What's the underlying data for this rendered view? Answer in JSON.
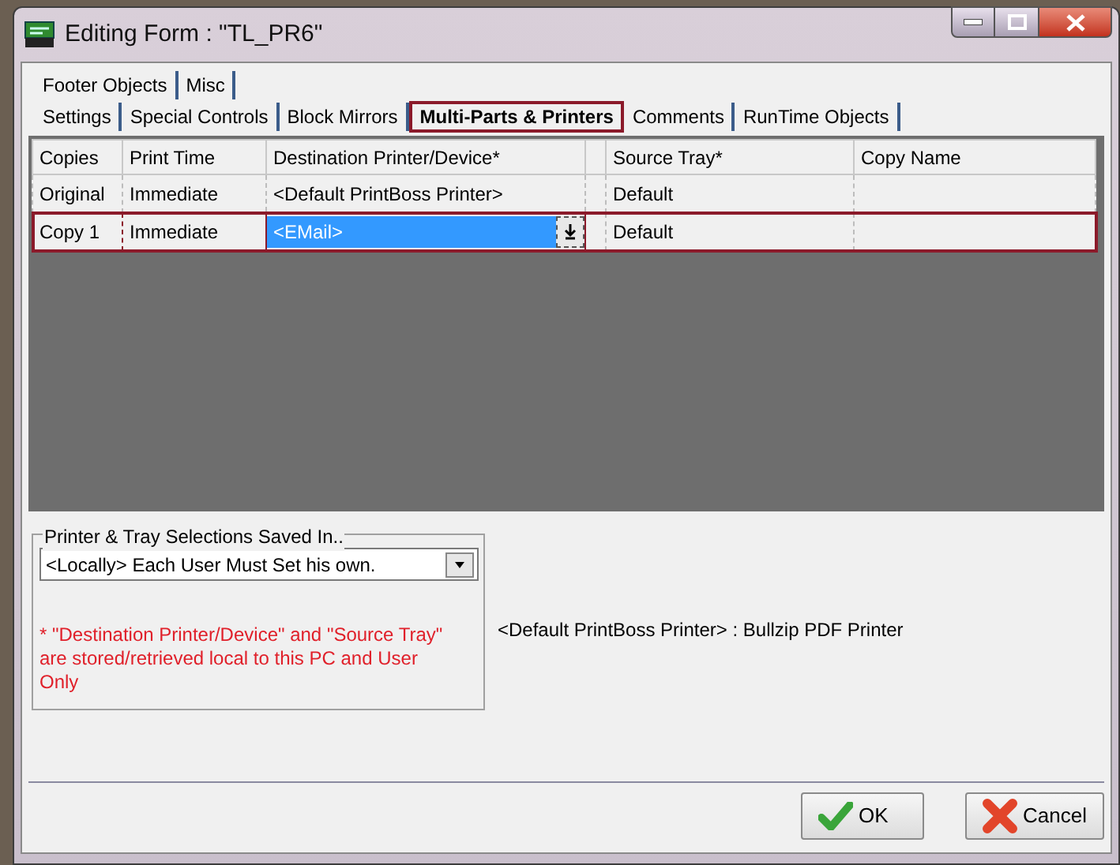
{
  "window": {
    "title": "Editing Form : \"TL_PR6\""
  },
  "tab_rows": [
    [
      {
        "label": "Footer Objects",
        "selected": false
      },
      {
        "label": "Misc",
        "selected": false
      }
    ],
    [
      {
        "label": "Settings",
        "selected": false
      },
      {
        "label": "Special Controls",
        "selected": false
      },
      {
        "label": "Block Mirrors",
        "selected": false
      },
      {
        "label": "Multi-Parts & Printers",
        "selected": true
      },
      {
        "label": "Comments",
        "selected": false
      },
      {
        "label": "RunTime Objects",
        "selected": false
      }
    ]
  ],
  "table": {
    "columns": [
      {
        "kind": "text",
        "label": "Copies"
      },
      {
        "kind": "text",
        "label": "Print Time"
      },
      {
        "kind": "text",
        "label": "Destination Printer/Device*"
      },
      {
        "kind": "spacer"
      },
      {
        "kind": "text",
        "label": "Source Tray*"
      },
      {
        "kind": "text",
        "label": "Copy Name"
      }
    ],
    "rows": [
      {
        "selected": false,
        "copies": "Original",
        "print_time": "Immediate",
        "destination": "<Default PrintBoss Printer>",
        "destination_editing": false,
        "source_tray": "Default"
      },
      {
        "selected": true,
        "copies": "Copy 1",
        "print_time": "Immediate",
        "destination": "<EMail>",
        "destination_editing": true,
        "source_tray": "Default"
      }
    ]
  },
  "saved_in": {
    "legend": "Printer & Tray Selections Saved In..",
    "value": "<Locally> Each User Must Set his own.",
    "note": "* \"Destination Printer/Device\" and \"Source Tray\" are stored/retrieved local to this PC and User Only"
  },
  "default_printer_info": "<Default PrintBoss Printer> : Bullzip PDF Printer",
  "buttons": [
    {
      "kind": "ok",
      "label": "OK"
    },
    {
      "kind": "cancel",
      "label": "Cancel"
    }
  ]
}
